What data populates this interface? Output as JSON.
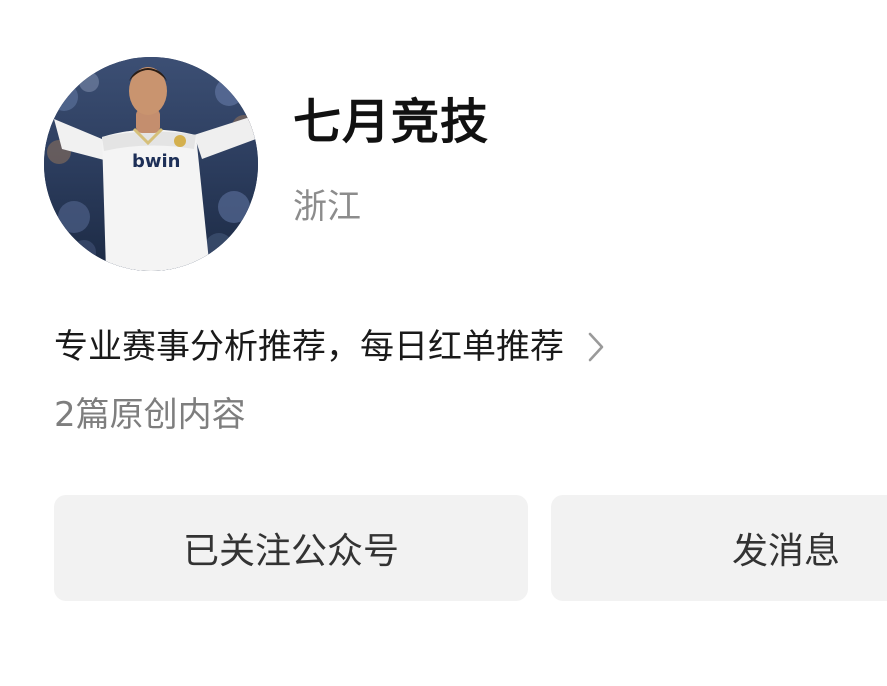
{
  "profile": {
    "avatar_icon": "profile-photo-football-player",
    "name": "七月竞技",
    "location": "浙江"
  },
  "bio": {
    "text": "专业赛事分析推荐，每日红单推荐",
    "chevron_icon": "chevron-right-icon"
  },
  "meta": {
    "original_count": "2篇原创内容"
  },
  "actions": {
    "follow_label": "已关注公众号",
    "message_label": "发消息"
  },
  "colors": {
    "button_bg": "#f2f2f2",
    "secondary_text": "#8c8c8c"
  }
}
